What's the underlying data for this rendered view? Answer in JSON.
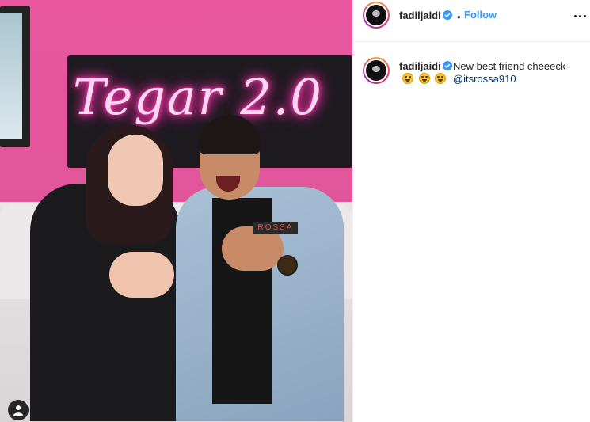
{
  "post": {
    "author": "fadiljaidi",
    "follow_label": "Follow",
    "separator": "•",
    "caption": "New best friend cheeeck",
    "emojis": [
      "grinning-squinting-face",
      "grinning-squinting-face",
      "grinning-squinting-face"
    ],
    "mention": "@itsrossa910"
  },
  "photo": {
    "neon_sign": "Tegar 2.0",
    "jacket_patch": "ROSSA",
    "tag_icon": "user-tag-icon"
  },
  "colors": {
    "accent": "#3897f0",
    "text": "#262626",
    "mention": "#00376b",
    "background_pink": "#e8579f"
  }
}
